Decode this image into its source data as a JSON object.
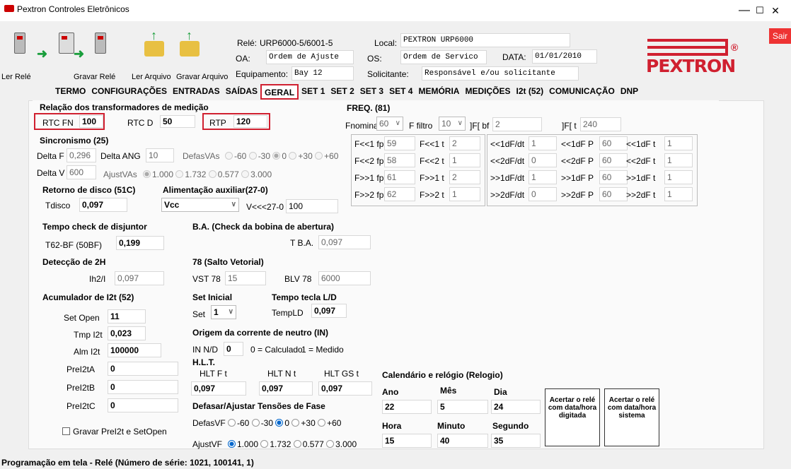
{
  "window": {
    "title": "Pextron Controles Eletrônicos",
    "minimize": "—",
    "maximize": "☐",
    "close": "✕",
    "exit": "Sair"
  },
  "toolbar": {
    "read_relay": "Ler Relé",
    "write_relay": "Gravar Relé",
    "read_file": "Ler Arquivo",
    "write_file": "Gravar Arquivo"
  },
  "header": {
    "rele_label": "Relé:",
    "rele_value": "URP6000-5/6001-5",
    "local_label": "Local:",
    "local_value": "PEXTRON URP6000",
    "oa_label": "OA:",
    "oa_value": "Ordem de Ajuste",
    "os_label": "OS:",
    "os_value": "Ordem de Servico",
    "data_label": "DATA:",
    "data_value": "01/01/2010",
    "equip_label": "Equipamento:",
    "equip_value": "Bay 12",
    "solic_label": "Solicitante:",
    "solic_value": "Responsável e/ou solicitante",
    "logo_text": "PEXTRON",
    "logo_mark": "®"
  },
  "tabs": [
    "TERMO",
    "CONFIGURAÇÕES",
    "ENTRADAS",
    "SAÍDAS",
    "GERAL",
    "SET 1",
    "SET 2",
    "SET 3",
    "SET 4",
    "MEMÓRIA",
    "MEDIÇÕES",
    "I2t (52)",
    "COMUNICAÇÃO",
    "DNP"
  ],
  "tab_active": "GERAL",
  "colors": {
    "accent_red": "#d02030",
    "radio_blue": "#0066cc",
    "logo_red": "#d02030"
  },
  "rt": {
    "title": "Relação dos transformadores de medição",
    "rtcfn_label": "RTC FN",
    "rtcfn_value": "100",
    "rtcd_label": "RTC D",
    "rtcd_value": "50",
    "rtp_label": "RTP",
    "rtp_value": "120"
  },
  "sync": {
    "title": "Sincronismo (25)",
    "deltaf_label": "Delta F",
    "deltaf_value": "0,296",
    "deltaang_label": "Delta ANG",
    "deltaang_value": "10",
    "defas_label": "DefasVAs",
    "defas_opts": [
      "-60",
      "-30",
      "0",
      "+30",
      "+60"
    ],
    "deltav_label": "Delta V",
    "deltav_value": "600",
    "ajust_label": "AjustVAs",
    "ajust_opts": [
      "1.000",
      "1.732",
      "0.577",
      "3.000"
    ]
  },
  "disco": {
    "title": "Retorno de disco (51C)",
    "tdisco_label": "Tdisco",
    "tdisco_value": "0,097"
  },
  "aux": {
    "title": "Alimentação auxiliar(27-0)",
    "supply_value": "Vcc",
    "v27_label": "V<<<27-0",
    "v27_value": "100"
  },
  "freq": {
    "title": "FREQ. (81)",
    "fnom_label": "Fnominal",
    "fnom_value": "60",
    "ffilt_label": "F filtro",
    "ffilt_value": "10",
    "fbf_label": "]F[ bf",
    "fbf_value": "2",
    "ft_label": "]F[ t",
    "ft_value": "240",
    "grid_a": [
      [
        "F<<1 fp",
        "59",
        "F<<1 t",
        "2"
      ],
      [
        "F<<2 fp",
        "58",
        "F<<2 t",
        "1"
      ],
      [
        "F>>1 fp",
        "61",
        "F>>1 t",
        "2"
      ],
      [
        "F>>2 fp",
        "62",
        "F>>2 t",
        "1"
      ]
    ],
    "grid_b": [
      [
        "<<1dF/dt",
        "1",
        "<<1dF P",
        "60",
        "<<1dF t",
        "1"
      ],
      [
        "<<2dF/dt",
        "0",
        "<<2dF P",
        "60",
        "<<2dF t",
        "1"
      ],
      [
        ">>1dF/dt",
        "1",
        ">>1dF P",
        "60",
        ">>1dF t",
        "1"
      ],
      [
        ">>2dF/dt",
        "0",
        ">>2dF P",
        "60",
        ">>2dF t",
        "1"
      ]
    ]
  },
  "check": {
    "title": "Tempo check de disjuntor",
    "t62_label": "T62-BF (50BF)",
    "t62_value": "0,199"
  },
  "ba": {
    "title": "B.A. (Check da bobina de abertura)",
    "tba_label": "T B.A.",
    "tba_value": "0,097"
  },
  "det2h": {
    "title": "Detecção de 2H",
    "ih_label": "Ih2/I",
    "ih_value": "0,097"
  },
  "salto": {
    "title": "78 (Salto Vetorial)",
    "vst_label": "VST 78",
    "vst_value": "15",
    "blv_label": "BLV 78",
    "blv_value": "6000"
  },
  "acc": {
    "title": "Acumulador de I2t (52)",
    "setopen_label": "Set Open",
    "setopen_value": "11",
    "tmp_label": "Tmp I2t",
    "tmp_value": "0,023",
    "alm_label": "Alm I2t",
    "alm_value": "100000",
    "prela_label": "PreI2tA",
    "prela_value": "0",
    "prelb_label": "PreI2tB",
    "prelb_value": "0",
    "prelc_label": "PreI2tC",
    "prelc_value": "0",
    "save_label": "Gravar PreI2t e SetOpen"
  },
  "setini": {
    "title": "Set Inicial",
    "set_label": "Set",
    "set_value": "1"
  },
  "templd": {
    "title": "Tempo tecla L/D",
    "label": "TempLD",
    "value": "0,097"
  },
  "neutro": {
    "title": "Origem da corrente de neutro (IN)",
    "innd_label": "IN N/D",
    "innd_value": "0",
    "calc": "0 = Calculado",
    "med": "1 = Medido"
  },
  "hlt": {
    "title": "H.L.T.",
    "f_label": "HLT F t",
    "f_value": "0,097",
    "n_label": "HLT N t",
    "n_value": "0,097",
    "gs_label": "HLT GS t",
    "gs_value": "0,097"
  },
  "defas": {
    "title": "Defasar/Ajustar Tensões de Fase",
    "defasvf_label": "DefasVF",
    "defasvf_opts": [
      "-60",
      "-30",
      "0",
      "+30",
      "+60"
    ],
    "ajustvf_label": "AjustVF",
    "ajustvf_opts": [
      "1.000",
      "1.732",
      "0.577",
      "3.000"
    ]
  },
  "cal": {
    "title": "Calendário e relógio (Relogio)",
    "ano_label": "Ano",
    "ano_value": "22",
    "mes_label": "Mês",
    "mes_value": "5",
    "dia_label": "Dia",
    "dia_value": "24",
    "hora_label": "Hora",
    "hora_value": "15",
    "min_label": "Minuto",
    "min_value": "40",
    "seg_label": "Segundo",
    "seg_value": "35",
    "btn_typed": "Acertar o relé com data/hora digitada",
    "btn_system": "Acertar o relé com data/hora sistema"
  },
  "status": "Programação em tela - Relé (Número de série: 1021, 100141, 1)"
}
